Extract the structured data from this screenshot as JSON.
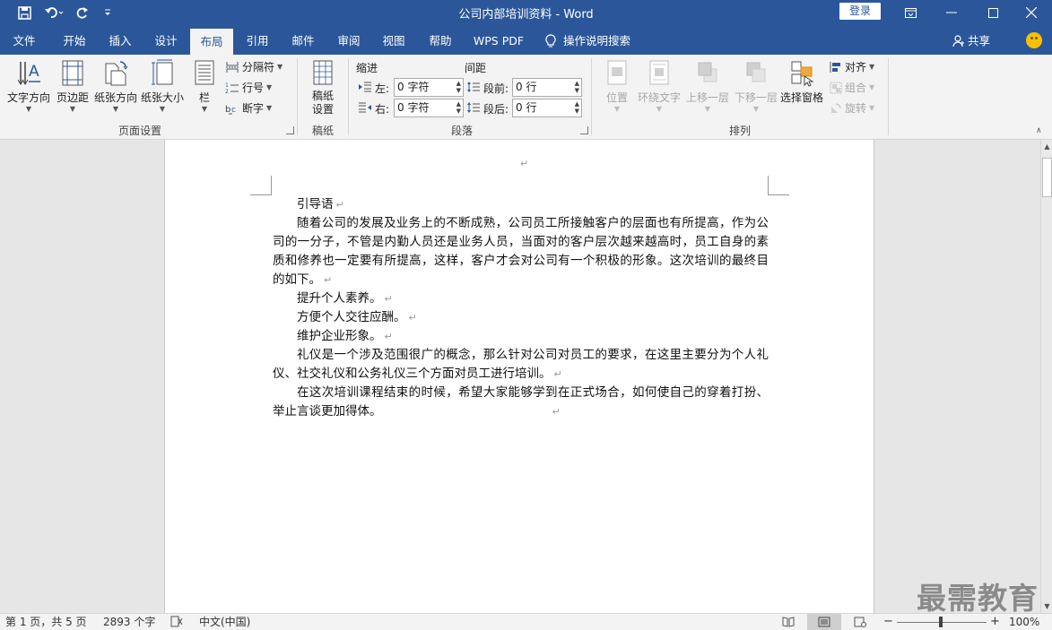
{
  "app": {
    "title": "公司内部培训资料  -  Word",
    "login_label": "登录"
  },
  "tabs": [
    {
      "label": "文件"
    },
    {
      "label": "开始"
    },
    {
      "label": "插入"
    },
    {
      "label": "设计"
    },
    {
      "label": "布局",
      "active": true
    },
    {
      "label": "引用"
    },
    {
      "label": "邮件"
    },
    {
      "label": "审阅"
    },
    {
      "label": "视图"
    },
    {
      "label": "帮助"
    },
    {
      "label": "WPS PDF"
    }
  ],
  "tell_me": "操作说明搜索",
  "share_label": "共享",
  "ribbon": {
    "page_setup": {
      "text_direction": "文字方向",
      "margins": "页边距",
      "orientation": "纸张方向",
      "size": "纸张大小",
      "columns": "栏",
      "breaks": "分隔符",
      "line_numbers": "行号",
      "hyphenation": "断字",
      "group_label": "页面设置"
    },
    "manuscript": {
      "button": "稿纸设置",
      "group_label": "稿纸"
    },
    "paragraph": {
      "indent_header": "缩进",
      "spacing_header": "间距",
      "left_label": "左:",
      "right_label": "右:",
      "before_label": "段前:",
      "after_label": "段后:",
      "left_value": "0 字符",
      "right_value": "0 字符",
      "before_value": "0 行",
      "after_value": "0 行",
      "group_label": "段落"
    },
    "arrange": {
      "position": "位置",
      "wrap_text": "环绕文字",
      "bring_forward": "上移一层",
      "send_backward": "下移一层",
      "selection_pane": "选择窗格",
      "align": "对齐",
      "group": "组合",
      "rotate": "旋转",
      "group_label": "排列"
    }
  },
  "document": {
    "title_line": "引导语",
    "paragraphs": [
      "随着公司的发展及业务上的不断成熟，公司员工所接触客户的层面也有所提高，作为公司的一分子，不管是内勤人员还是业务人员，当面对的客户层次越来越高时，员工自身的素质和修养也一定要有所提高，这样，客户才会对公司有一个积极的形象。这次培训的最终目的如下。",
      "提升个人素养。",
      "方便个人交往应酬。",
      "维护企业形象。",
      "礼仪是一个涉及范围很广的概念，那么针对公司对员工的要求，在这里主要分为个人礼仪、社交礼仪和公务礼仪三个方面对员工进行培训。",
      "在这次培训课程结束的时候，希望大家能够学到在正式场合，如何使自己的穿着打扮、举止言谈更加得体。"
    ]
  },
  "watermark": "最需教育",
  "status": {
    "page": "第 1 页，共 5 页",
    "words": "2893 个字",
    "language": "中文(中国)",
    "zoom": "100%",
    "zoom_minus": "−",
    "zoom_plus": "+"
  },
  "colors": {
    "brand": "#2b579a",
    "ribbon_bg": "#f3f3f3"
  }
}
